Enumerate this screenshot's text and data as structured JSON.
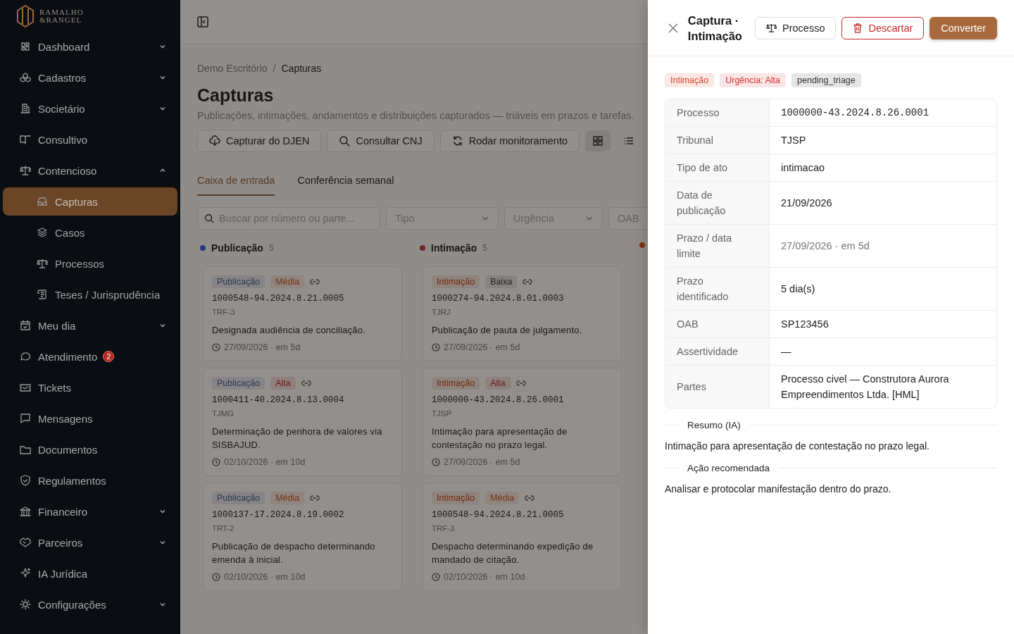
{
  "sidebar": {
    "logo": {
      "line1": "RAMALHO",
      "line2": "&RANGEL"
    },
    "items": [
      {
        "label": "Dashboard",
        "selected": false,
        "expanded": false
      },
      {
        "label": "Cadastros",
        "selected": false,
        "expanded": false
      },
      {
        "label": "Societário",
        "selected": false,
        "expanded": false
      },
      {
        "label": "Consultivo",
        "selected": false
      },
      {
        "label": "Contencioso",
        "selected": false,
        "expanded": true,
        "children": [
          {
            "label": "Capturas",
            "selected": true
          },
          {
            "label": "Casos",
            "selected": false
          },
          {
            "label": "Processos",
            "selected": false
          },
          {
            "label": "Teses / Jurisprudência",
            "selected": false
          }
        ]
      },
      {
        "label": "Meu dia",
        "selected": false,
        "expanded": false
      },
      {
        "label": "Atendimento",
        "selected": false,
        "badge": "2"
      },
      {
        "label": "Tickets",
        "selected": false
      },
      {
        "label": "Mensagens",
        "selected": false
      },
      {
        "label": "Documentos",
        "selected": false
      },
      {
        "label": "Regulamentos",
        "selected": false
      },
      {
        "label": "Financeiro",
        "selected": false,
        "expanded": false
      },
      {
        "label": "Parceiros",
        "selected": false,
        "expanded": false
      },
      {
        "label": "IA Jurídica",
        "selected": false
      },
      {
        "label": "Configurações",
        "selected": false,
        "expanded": false
      }
    ]
  },
  "breadcrumb": {
    "items": [
      "Demo Escritório",
      "Capturas"
    ],
    "separator": "/"
  },
  "page": {
    "title": "Capturas",
    "subtitle": "Publicações, intimações, andamentos e distribuições capturados — triáveis em prazos e tarefas."
  },
  "actions": [
    "Capturar do DJEN",
    "Consultar CNJ",
    "Rodar monitoramento"
  ],
  "view_toggle": [
    {
      "selected": true
    },
    {
      "selected": false
    }
  ],
  "tabs": [
    {
      "label": "Caixa de entrada",
      "selected": true
    },
    {
      "label": "Conferência semanal",
      "selected": false
    }
  ],
  "filters": {
    "search": {
      "placeholder": "Buscar por número ou parte..."
    },
    "selects": [
      "Tipo",
      "Urgência",
      "OAB"
    ]
  },
  "columns": [
    {
      "label": "Publicação",
      "count": "5",
      "kind": "publication",
      "cards": [
        {
          "type": {
            "label": "Publicação",
            "kind": "publication"
          },
          "urgency": {
            "label": "Média",
            "kind": "medium"
          },
          "number": "1000548-94.2024.8.21.0005",
          "court": "TRF-3",
          "text": "Designada audiência de conciliação.",
          "due": "27/09/2026 · em 5d"
        },
        {
          "type": {
            "label": "Publicação",
            "kind": "publication"
          },
          "urgency": {
            "label": "Alta",
            "kind": "high"
          },
          "number": "1000411-40.2024.8.13.0004",
          "court": "TJMG",
          "text": "Determinação de penhora de valores via SISBAJUD.",
          "due": "02/10/2026 · em 10d"
        },
        {
          "type": {
            "label": "Publicação",
            "kind": "publication"
          },
          "urgency": {
            "label": "Média",
            "kind": "medium"
          },
          "number": "1000137-17.2024.8.19.0002",
          "court": "TRT-2",
          "text": "Publicação de despacho determinando emenda à inicial.",
          "due": "02/10/2026 · em 10d"
        }
      ]
    },
    {
      "label": "Intimação",
      "count": "5",
      "kind": "summons",
      "cards": [
        {
          "type": {
            "label": "Intimação",
            "kind": "summons"
          },
          "urgency": {
            "label": "Baixa",
            "kind": "low"
          },
          "number": "1000274-94.2024.8.01.0003",
          "court": "TJRJ",
          "text": "Publicação de pauta de julgamento.",
          "due": "27/09/2026 · em 5d"
        },
        {
          "type": {
            "label": "Intimação",
            "kind": "summons"
          },
          "urgency": {
            "label": "Alta",
            "kind": "high"
          },
          "number": "1000000-43.2024.8.26.0001",
          "court": "TJSP",
          "text": "Intimação para apresentação de contestação no prazo legal.",
          "due": "27/09/2026 · em 5d"
        },
        {
          "type": {
            "label": "Intimação",
            "kind": "summons"
          },
          "urgency": {
            "label": "Média",
            "kind": "medium"
          },
          "number": "1000548-94.2024.8.21.0005",
          "court": "TRF-3",
          "text": "Despacho determinando expedição de mandado de citação.",
          "due": "02/10/2026 · em 10d"
        }
      ]
    },
    {
      "kind": "other"
    }
  ],
  "drawer": {
    "title": "Captura · Intimação",
    "buttons": [
      {
        "label": "Processo",
        "kind": "default"
      },
      {
        "label": "Descartar",
        "kind": "danger"
      },
      {
        "label": "Converter",
        "kind": "primary"
      }
    ],
    "tags": [
      {
        "label": "Intimação",
        "color": "#d4452b"
      },
      {
        "label": "Urgência: Alta",
        "color": "#d32f2f"
      },
      {
        "label": "pending_triage",
        "color": "#333333"
      }
    ],
    "fields": [
      {
        "label": "Processo",
        "value": "1000000-43.2024.8.26.0001",
        "kind": "mono"
      },
      {
        "label": "Tribunal",
        "value": "TJSP",
        "kind": "text"
      },
      {
        "label": "Tipo de ato",
        "value": "intimacao",
        "kind": "text"
      },
      {
        "label": "Data de publicação",
        "value": "21/09/2026",
        "kind": "text"
      },
      {
        "label": "Prazo / data limite",
        "value": "27/09/2026 · em 5d",
        "kind": "muted"
      },
      {
        "label": "Prazo identificado",
        "value": "5 dia(s)",
        "kind": "text"
      },
      {
        "label": "OAB",
        "value": "SP123456",
        "kind": "text"
      },
      {
        "label": "Assertividade",
        "value": "—",
        "kind": "text"
      },
      {
        "label": "Partes",
        "value": "Processo civel — Construtora Aurora Empreendimentos Ltda. [HML]",
        "kind": "text"
      }
    ],
    "sections": [
      {
        "heading": "Resumo (IA)",
        "text": "Intimação para apresentação de contestação no prazo legal."
      },
      {
        "heading": "Ação recomendada",
        "text": "Analisar e protocolar manifestação dentro do prazo."
      }
    ]
  }
}
